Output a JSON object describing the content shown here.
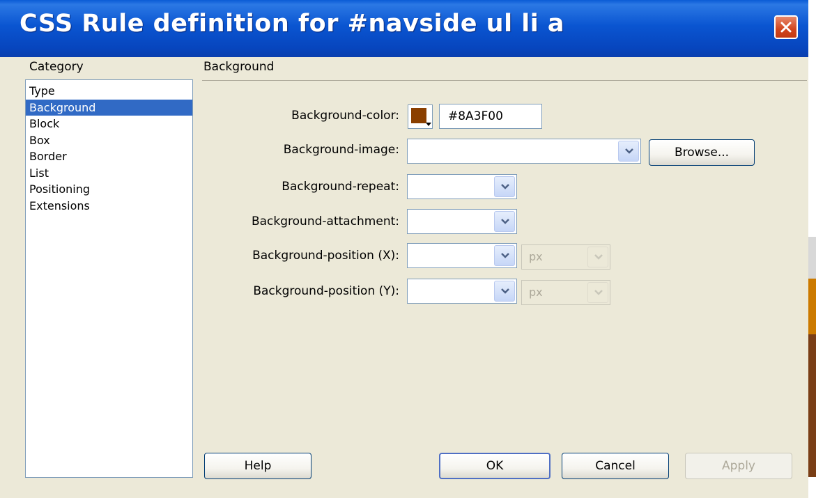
{
  "window": {
    "title": "CSS Rule definition for #navside ul li a",
    "close_icon": "close-icon"
  },
  "category": {
    "label": "Category",
    "items": [
      "Type",
      "Background",
      "Block",
      "Box",
      "Border",
      "List",
      "Positioning",
      "Extensions"
    ],
    "selected": "Background"
  },
  "panel": {
    "heading": "Background",
    "fields": {
      "color_label": "Background-color:",
      "color_value": "#8A3F00",
      "image_label": "Background-image:",
      "image_value": "",
      "browse_label": "Browse...",
      "repeat_label": "Background-repeat:",
      "repeat_value": "",
      "attachment_label": "Background-attachment:",
      "attachment_value": "",
      "pos_x_label": "Background-position (X):",
      "pos_x_value": "",
      "pos_x_unit": "px",
      "pos_y_label": "Background-position (Y):",
      "pos_y_value": "",
      "pos_y_unit": "px"
    }
  },
  "buttons": {
    "help": "Help",
    "ok": "OK",
    "cancel": "Cancel",
    "apply": "Apply"
  },
  "colors": {
    "swatch": "#8a3f00",
    "selection": "#316ac5",
    "titlebar": "#0a55d1",
    "dialog_bg": "#ece9d8"
  }
}
